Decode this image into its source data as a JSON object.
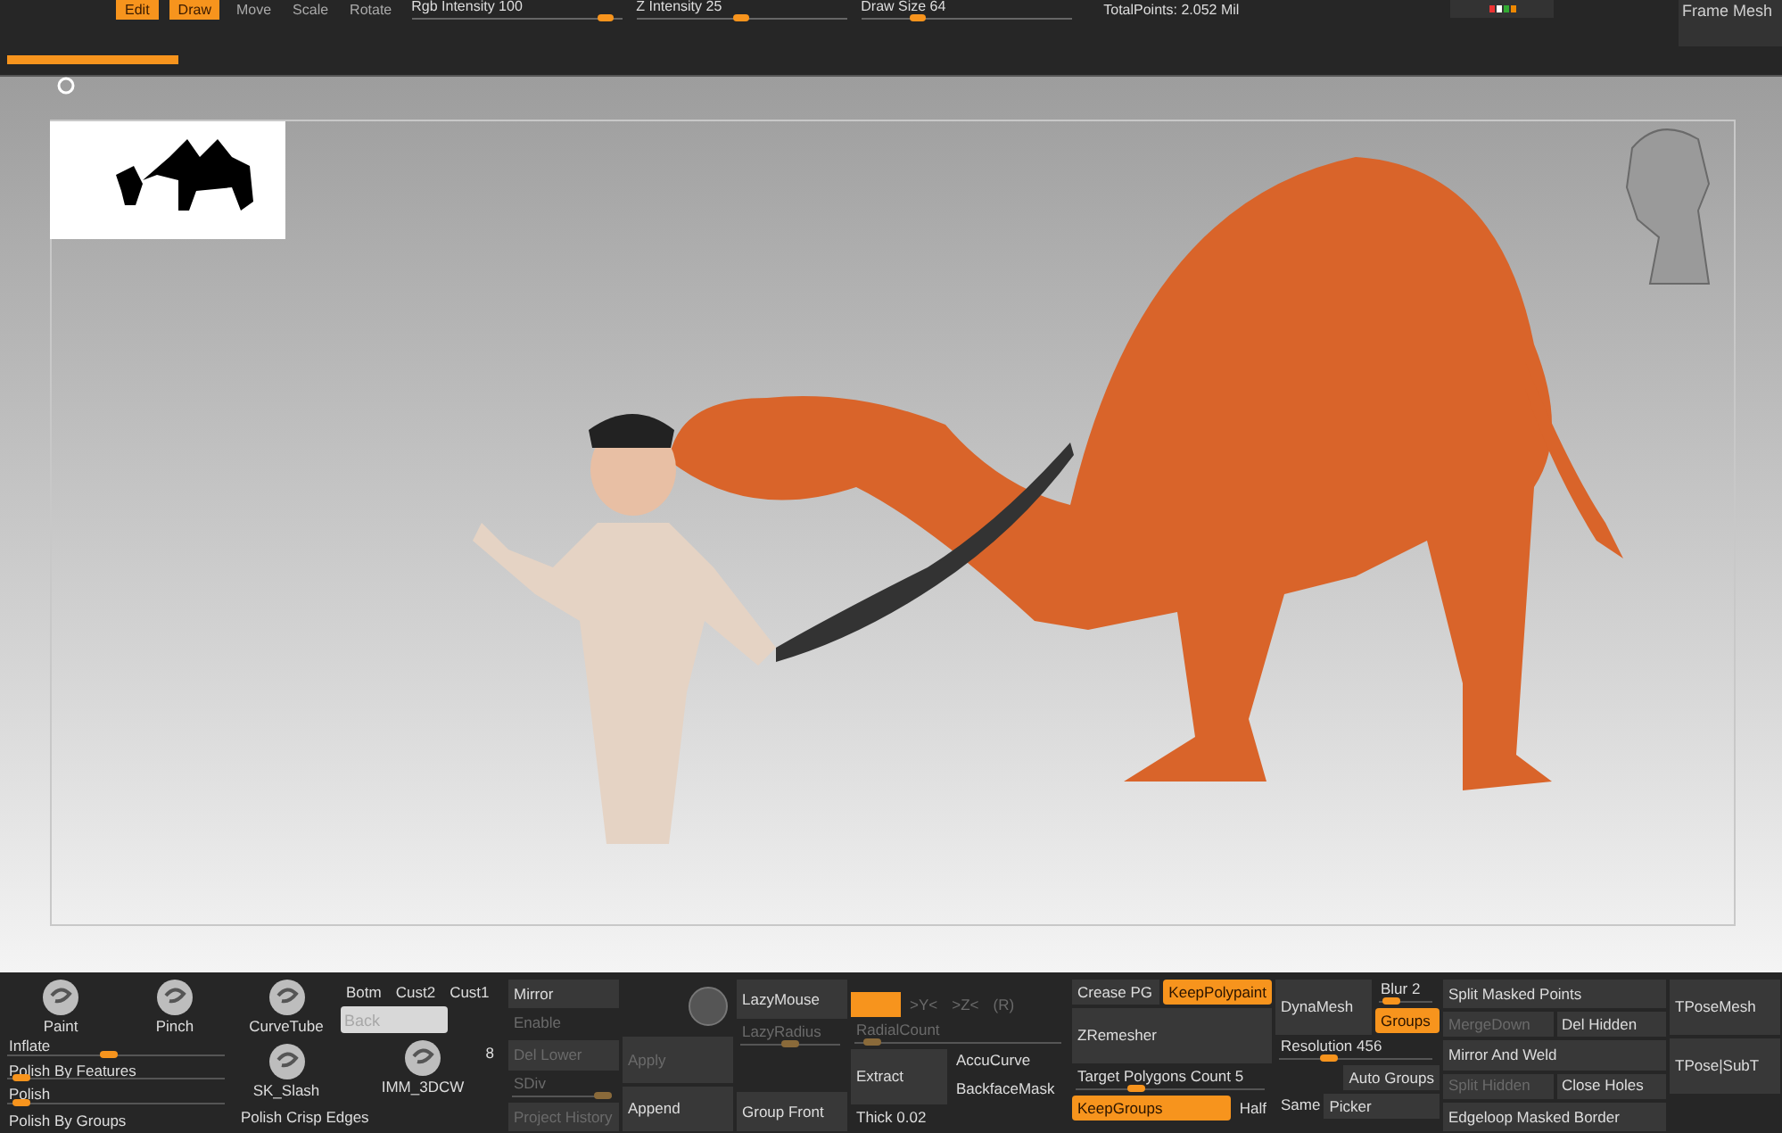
{
  "top_bar": {
    "buttons": [
      {
        "label": "Edit",
        "on": true
      },
      {
        "label": "Draw",
        "on": true
      },
      {
        "label": "Move",
        "on": false
      },
      {
        "label": "Scale",
        "on": false
      },
      {
        "label": "Rotate",
        "on": false
      }
    ],
    "sliders": [
      {
        "label": "Rgb Intensity 100",
        "level": 0.96
      },
      {
        "label": "Z Intensity 25",
        "level": 0.5
      },
      {
        "label": "Draw Size 64",
        "level": 0.25
      }
    ],
    "total_points": "TotalPoints: 2.052 Mil",
    "frame_button": "Frame Mesh",
    "progress": {
      "level": 1
    }
  },
  "palette": [
    [
      {
        "kind": "brush_row",
        "items": [
          {
            "label": "Paint"
          },
          {
            "label": "Pinch"
          }
        ]
      },
      {
        "kind": "slider",
        "label": "Inflate",
        "level": 0.46,
        "disabled": false
      },
      {
        "kind": "slider",
        "label": "Polish By Features",
        "level": 0.03,
        "disabled": false
      },
      {
        "kind": "slider",
        "label": "Polish",
        "level": 0.03,
        "disabled": false
      },
      {
        "kind": "text",
        "label": "Polish By Groups",
        "disabled": false
      }
    ],
    [
      {
        "kind": "brush",
        "label": "CurveTube"
      },
      {
        "kind": "brush",
        "label": "SK_Slash"
      },
      {
        "kind": "text",
        "label": "Polish Crisp Edges",
        "disabled": false
      }
    ],
    [
      {
        "kind": "row",
        "items": [
          {
            "kind": "tab",
            "label": "Botm",
            "disabled": false
          },
          {
            "kind": "tab",
            "label": "Cust2",
            "disabled": false
          },
          {
            "kind": "tab",
            "label": "Cust1",
            "disabled": false
          }
        ]
      },
      {
        "kind": "field",
        "placeholder": "Back"
      },
      {
        "kind": "brush",
        "label": "IMM_3DCW",
        "badge": "8"
      }
    ],
    [
      {
        "kind": "button",
        "label": "Mirror",
        "on": false,
        "disabled": false
      },
      {
        "kind": "text",
        "label": "Enable",
        "disabled": true
      },
      {
        "kind": "button",
        "label": "Del Lower",
        "on": false,
        "disabled": true
      },
      {
        "kind": "slider",
        "label": "SDiv",
        "level": 1,
        "disabled": true
      },
      {
        "kind": "button",
        "label": "Project History",
        "on": false,
        "disabled": true
      }
    ],
    [
      {
        "kind": "icon"
      },
      {
        "kind": "button",
        "label": "Apply",
        "on": false,
        "disabled": true
      },
      {
        "kind": "button",
        "label": "Append",
        "on": false,
        "disabled": false
      }
    ],
    [
      {
        "kind": "button",
        "label": "LazyMouse",
        "on": false,
        "disabled": false
      },
      {
        "kind": "slider",
        "label": "LazyRadius",
        "level": 0.5,
        "disabled": true
      },
      {
        "kind": "spacer"
      },
      {
        "kind": "button",
        "label": "Group Front",
        "on": false,
        "disabled": false
      }
    ],
    [
      {
        "kind": "spacer"
      },
      {
        "kind": "row",
        "items": [
          {
            "kind": "swatch",
            "on": true
          },
          {
            "kind": "tab",
            "label": ">Y<",
            "disabled": true
          },
          {
            "kind": "tab",
            "label": ">Z<",
            "disabled": true
          },
          {
            "kind": "tab",
            "label": "(R)",
            "disabled": true
          }
        ]
      },
      {
        "kind": "slider",
        "label": "RadialCount",
        "level": 0.05,
        "disabled": true
      },
      {
        "kind": "pair",
        "big": {
          "label": "Extract",
          "on": false
        },
        "items": [
          {
            "kind": "text",
            "label": "AccuCurve",
            "disabled": false
          },
          {
            "kind": "text",
            "label": "BackfaceMask",
            "disabled": false
          }
        ]
      },
      {
        "kind": "text",
        "label": "Thick 0.02",
        "disabled": false
      }
    ],
    [
      {
        "kind": "row",
        "items": [
          {
            "kind": "button",
            "label": "Crease PG",
            "on": false,
            "disabled": false
          },
          {
            "kind": "button",
            "label": "KeepPolypaint",
            "on": true,
            "disabled": false
          }
        ]
      },
      {
        "kind": "big_button",
        "label": "ZRemesher",
        "on": false
      },
      {
        "kind": "slider",
        "label": "Target Polygons Count 5",
        "level": 0.3,
        "disabled": false
      },
      {
        "kind": "row",
        "items": [
          {
            "kind": "button",
            "label": "KeepGroups",
            "on": true,
            "disabled": false
          },
          {
            "kind": "tab",
            "label": "Half",
            "disabled": false
          }
        ]
      }
    ],
    [
      {
        "kind": "pair",
        "big": {
          "label": "DynaMesh",
          "on": false
        },
        "items": [
          {
            "kind": "slider",
            "label": "Blur 2",
            "level": 0.1,
            "disabled": false
          },
          {
            "kind": "button",
            "label": "Groups",
            "on": true,
            "disabled": false
          }
        ]
      },
      {
        "kind": "slider",
        "label": "Resolution 456",
        "level": 0.3,
        "disabled": false
      },
      {
        "kind": "row",
        "items": [
          {
            "kind": "spacer"
          },
          {
            "kind": "button",
            "label": "Auto Groups",
            "on": false,
            "disabled": false
          }
        ]
      },
      {
        "kind": "row",
        "items": [
          {
            "kind": "text",
            "label": "Same",
            "disabled": false
          },
          {
            "kind": "button",
            "label": "Picker",
            "on": false,
            "disabled": false
          }
        ]
      }
    ],
    [
      {
        "kind": "button",
        "label": "Split Masked Points",
        "on": false,
        "disabled": false
      },
      {
        "kind": "row",
        "items": [
          {
            "kind": "button",
            "label": "MergeDown",
            "on": false,
            "disabled": true
          },
          {
            "kind": "button",
            "label": "Del Hidden",
            "on": false,
            "disabled": false
          }
        ]
      },
      {
        "kind": "button",
        "label": "Mirror And Weld",
        "on": false,
        "disabled": false
      },
      {
        "kind": "row",
        "items": [
          {
            "kind": "button",
            "label": "Split Hidden",
            "on": false,
            "disabled": true
          },
          {
            "kind": "button",
            "label": "Close Holes",
            "on": false,
            "disabled": false
          }
        ]
      },
      {
        "kind": "button",
        "label": "Edgeloop Masked Border",
        "on": false,
        "disabled": false
      }
    ],
    [
      {
        "kind": "big_button",
        "label": "TPoseMesh",
        "on": false
      },
      {
        "kind": "big_button",
        "label": "TPose|SubT",
        "on": false
      }
    ]
  ]
}
